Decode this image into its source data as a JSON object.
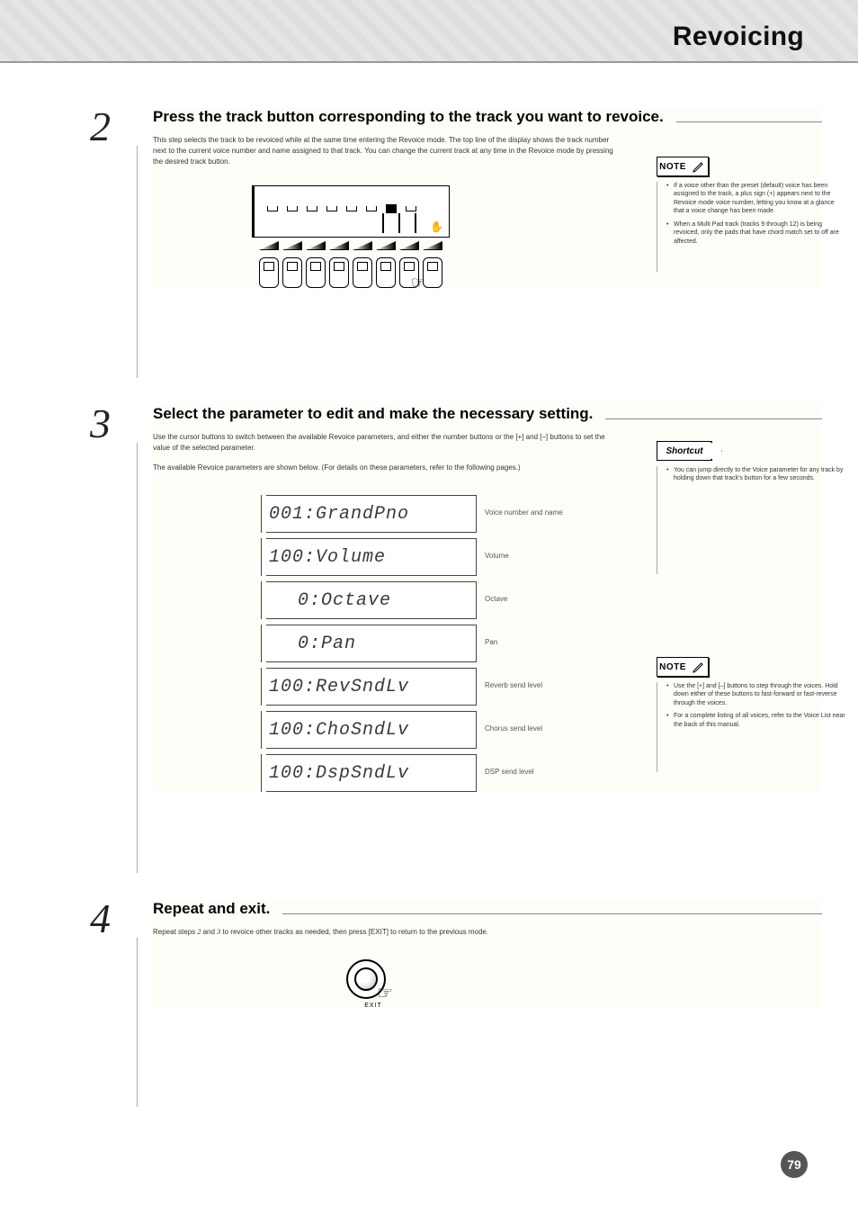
{
  "header": {
    "title": "Revoicing"
  },
  "steps": {
    "s2": {
      "num": "2",
      "heading": "Press the track button corresponding to the track you want to revoice.",
      "body": "This step selects the track to be revoiced while at the same time entering the Revoice mode. The top line of the display shows the track number next to the current voice number and name assigned to that track. You can change the current track at any time in the Revoice mode by pressing the desired track button."
    },
    "s3": {
      "num": "3",
      "heading": "Select the parameter to edit and make the necessary setting.",
      "body_1": "Use the cursor buttons to switch between the available Revoice parameters, and either the number buttons or the [+] and [–] buttons to set the value of the selected parameter.",
      "body_2": "The available Revoice parameters are shown below. (For details on these parameters, refer to the following pages.)"
    },
    "s4": {
      "num": "4",
      "heading": "Repeat and exit.",
      "body": "Repeat steps 2 and 3 to revoice other tracks as needed, then press [EXIT] to return to the previous mode."
    }
  },
  "lcd": [
    {
      "value": "001:GrandPno",
      "label": "Voice number and name"
    },
    {
      "value": "100:Volume",
      "label": "Volume"
    },
    {
      "value": "0:Octave",
      "label": "Octave"
    },
    {
      "value": "0:Pan",
      "label": "Pan"
    },
    {
      "value": "100:RevSndLv",
      "label": "Reverb send level"
    },
    {
      "value": "100:ChoSndLv",
      "label": "Chorus send level"
    },
    {
      "value": "100:DspSndLv",
      "label": "DSP send level"
    }
  ],
  "sidebar": {
    "note1": {
      "label": "NOTE",
      "lines": [
        "If a voice other than the preset (default) voice has been assigned to the track, a plus sign (+) appears next to the Revoice mode voice number, letting you know at a glance that a voice change has been made.",
        "When a Multi Pad track (tracks 9 through 12) is being revoiced, only the pads that have chord match set to off are affected."
      ]
    },
    "shortcut": {
      "label": "Shortcut",
      "text": "You can jump directly to the Voice parameter for any track by holding down that track's button for a few seconds."
    },
    "note2": {
      "label": "NOTE",
      "lines": [
        "Use the [+] and [–] buttons to step through the voices. Hold down either of these buttons to fast-forward or fast-reverse through the voices.",
        "For a complete listing of all voices, refer to the Voice List near the back of this manual."
      ]
    }
  },
  "exit_caption": "EXIT",
  "page_number": "79"
}
